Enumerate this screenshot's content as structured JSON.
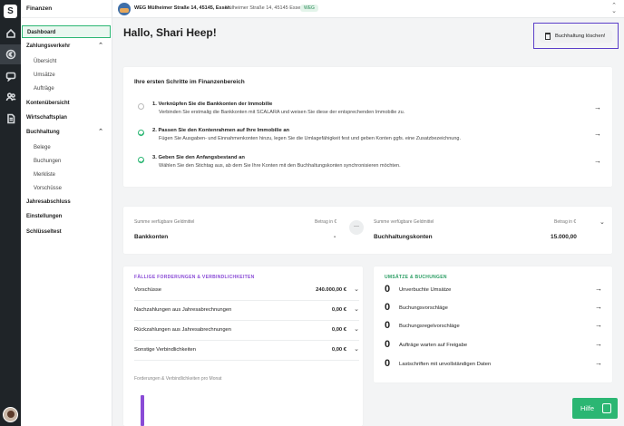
{
  "sidebar": {
    "section_title": "Finanzen",
    "items": [
      {
        "label": "Dashboard"
      },
      {
        "label": "Zahlungsverkehr"
      },
      {
        "label": "Übersicht"
      },
      {
        "label": "Umsätze"
      },
      {
        "label": "Aufträge"
      },
      {
        "label": "Kontenübersicht"
      },
      {
        "label": "Wirtschaftsplan"
      },
      {
        "label": "Buchhaltung"
      },
      {
        "label": "Belege"
      },
      {
        "label": "Buchungen"
      },
      {
        "label": "Merkliste"
      },
      {
        "label": "Vorschüsse"
      },
      {
        "label": "Jahresabschluss"
      },
      {
        "label": "Einstellungen"
      },
      {
        "label": "Schlüsseltest"
      }
    ]
  },
  "topbar": {
    "property": "WEG Mülheimer Straße 14, 45145, Essen",
    "address": "Mülheimer Straße 14, 45145 Essen",
    "badge": "WEG"
  },
  "main": {
    "greeting": "Hallo, Shari Heep!",
    "delete_button": "Buchhaltung löschen!",
    "steps": {
      "title": "Ihre ersten Schritte im Finanzenbereich",
      "items": [
        {
          "title": "1.  Verknüpfen Sie die Bankkonten der Immobilie",
          "desc": "Verbinden Sie erstmalig die Bankkonten mit SCALARA und weisen Sie diese der entsprechenden Immobilie zu.",
          "done": false
        },
        {
          "title": "2.  Passen Sie den Kontenrahmen auf Ihre Immobilie an",
          "desc": "Fügen Sie Ausgaben- und Einnahmenkonten hinzu, legen Sie die Umlagefähigkeit fest und geben Konten ggfs. eine Zusatzbezeichnung.",
          "done": true
        },
        {
          "title": "3.  Geben Sie den Anfangsbestand an",
          "desc": "Wählen Sie den Stichtag aus, ab dem Sie Ihre Konten mit den Buchhaltungskonten synchronisieren möchten.",
          "done": true
        }
      ]
    },
    "funds": {
      "left": {
        "label": "Summe verfügbare Geldmittel",
        "amount_label": "Betrag in €",
        "name": "Bankkonten",
        "value": "-"
      },
      "right": {
        "label": "Summe verfügbare Geldmittel",
        "amount_label": "Betrag in €",
        "name": "Buchhaltungskonten",
        "value": "15.000,00"
      }
    },
    "receivables": {
      "title": "FÄLLIGE FORDERUNGEN & VERBINDLICHKEITEN",
      "rows": [
        {
          "name": "Vorschüsse",
          "value": "240.000,00 €"
        },
        {
          "name": "Nachzahlungen aus Jahresabrechnungen",
          "value": "0,00 €"
        },
        {
          "name": "Rückzahlungen aus Jahresabrechnungen",
          "value": "0,00 €"
        },
        {
          "name": "Sonstige Verbindlichkeiten",
          "value": "0,00 €"
        }
      ],
      "chart_caption": "Forderungen & Verbindlichkeiten pro Monat"
    },
    "transactions": {
      "title": "UMSÄTZE & BUCHUNGEN",
      "rows": [
        {
          "count": "0",
          "name": "Unverbuchte Umsätze"
        },
        {
          "count": "0",
          "name": "Buchungsvorschläge"
        },
        {
          "count": "0",
          "name": "Buchungsregelvorschläge"
        },
        {
          "count": "0",
          "name": "Aufträge warten auf Freigabe"
        },
        {
          "count": "0",
          "name": "Lastschriften mit unvollständigen Daten"
        }
      ]
    },
    "help_button": "Hilfe"
  }
}
